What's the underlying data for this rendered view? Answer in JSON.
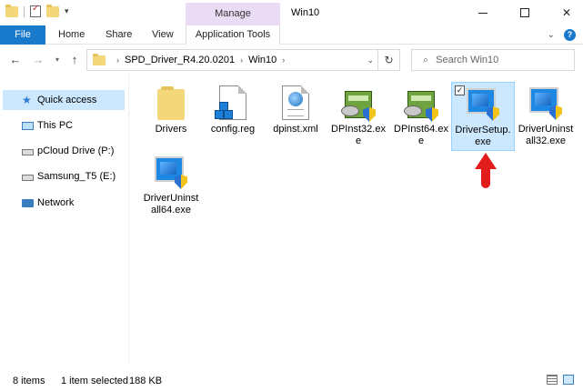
{
  "window": {
    "title": "Win10",
    "contextual_tab_group": "Manage"
  },
  "ribbon": {
    "tabs": [
      "File",
      "Home",
      "Share",
      "View",
      "Application Tools"
    ]
  },
  "address_bar": {
    "path": [
      "SPD_Driver_R4.20.0201",
      "Win10"
    ],
    "search_placeholder": "Search Win10"
  },
  "nav_pane": {
    "items": [
      {
        "label": "Quick access",
        "icon": "star-icon",
        "selected": true
      },
      {
        "label": "This PC",
        "icon": "computer-icon"
      },
      {
        "label": "pCloud Drive (P:)",
        "icon": "drive-icon"
      },
      {
        "label": "Samsung_T5 (E:)",
        "icon": "drive-icon"
      },
      {
        "label": "Network",
        "icon": "network-icon"
      }
    ]
  },
  "files": [
    {
      "name": "Drivers",
      "type": "folder"
    },
    {
      "name": "config.reg",
      "type": "registry"
    },
    {
      "name": "dpinst.xml",
      "type": "xml"
    },
    {
      "name": "DPInst32.exe",
      "type": "installer"
    },
    {
      "name": "DPInst64.exe",
      "type": "installer"
    },
    {
      "name": "DriverSetup.exe",
      "type": "setup",
      "selected": true
    },
    {
      "name": "DriverUninstall32.exe",
      "type": "setup"
    },
    {
      "name": "DriverUninstall64.exe",
      "type": "setup"
    }
  ],
  "status": {
    "item_count": "8 items",
    "selection": "1 item selected",
    "size": "188 KB"
  },
  "colors": {
    "accent": "#1979ca",
    "selection": "#cce8ff",
    "manage_tab": "#eadcf5",
    "arrow": "#e21b1b"
  }
}
